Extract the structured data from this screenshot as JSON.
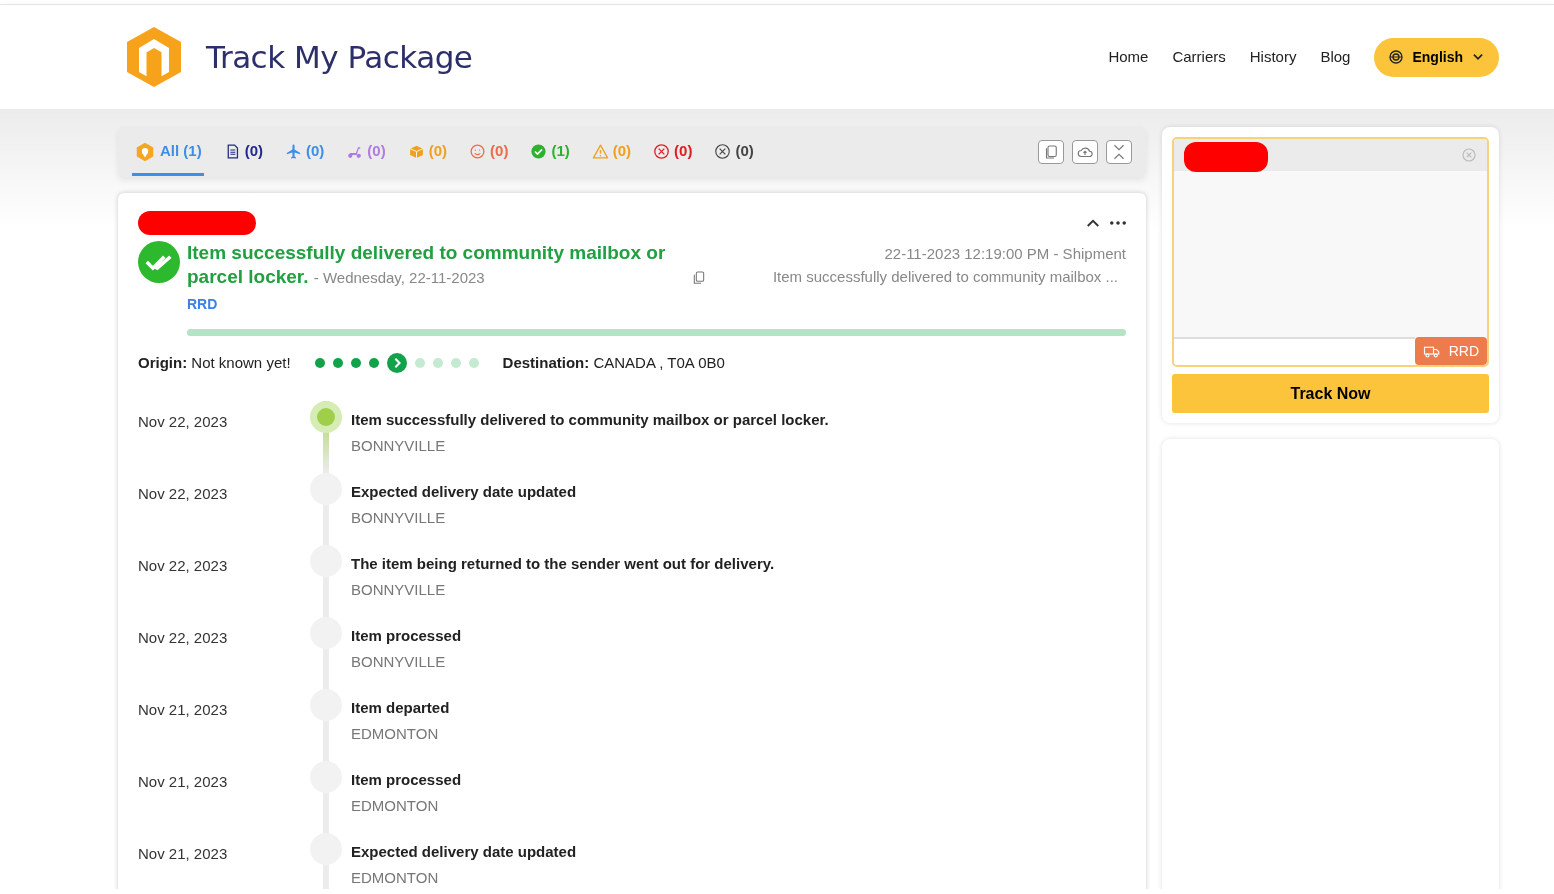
{
  "brand": {
    "name": "Track My Package"
  },
  "nav": {
    "links": [
      "Home",
      "Carriers",
      "History",
      "Blog"
    ],
    "language": "English"
  },
  "tabs": [
    {
      "kind": "all",
      "label": "All",
      "count": "(1)",
      "color": "#3d8ee8",
      "selected": true
    },
    {
      "kind": "document",
      "count": "(0)",
      "color": "#1f2a8a",
      "selected": false
    },
    {
      "kind": "plane",
      "count": "(0)",
      "color": "#3d8ee8",
      "selected": false
    },
    {
      "kind": "scooter",
      "count": "(0)",
      "color": "#b07be0",
      "selected": false
    },
    {
      "kind": "box",
      "count": "(0)",
      "color": "#f0a020",
      "selected": false
    },
    {
      "kind": "face",
      "count": "(0)",
      "color": "#ec6b4a",
      "selected": false
    },
    {
      "kind": "check",
      "count": "(1)",
      "color": "#2db22d",
      "selected": false
    },
    {
      "kind": "warning",
      "count": "(0)",
      "color": "#f0a020",
      "selected": false
    },
    {
      "kind": "error",
      "count": "(0)",
      "color": "#e01b24",
      "selected": false
    },
    {
      "kind": "cancel",
      "count": "(0)",
      "color": "#444444",
      "selected": false
    }
  ],
  "shipment": {
    "status_title": "Item successfully delivered to community mailbox or parcel locker.",
    "status_date": "- Wednesday, 22-11-2023",
    "carrier": "RRD",
    "updated": "22-11-2023 12:19:00 PM - Shipment",
    "summary": "Item successfully delivered to community mailbox ...",
    "progress": {
      "level": 1
    },
    "origin_label": "Origin:",
    "origin": "Not known yet!",
    "destination_label": "Destination:",
    "destination": "CANADA , T0A 0B0",
    "route_dots": [
      {
        "kind": "done"
      },
      {
        "kind": "done"
      },
      {
        "kind": "done"
      },
      {
        "kind": "done"
      },
      {
        "kind": "current"
      },
      {
        "kind": "pending"
      },
      {
        "kind": "pending"
      },
      {
        "kind": "pending"
      },
      {
        "kind": "pending"
      }
    ],
    "events": [
      {
        "date": "Nov 22, 2023",
        "title": "Item successfully delivered to community mailbox or parcel locker.",
        "location": "BONNYVILLE",
        "current": true
      },
      {
        "date": "Nov 22, 2023",
        "title": "Expected delivery date updated",
        "location": "BONNYVILLE",
        "current": false
      },
      {
        "date": "Nov 22, 2023",
        "title": "The item being returned to the sender went out for delivery.",
        "location": "BONNYVILLE",
        "current": false
      },
      {
        "date": "Nov 22, 2023",
        "title": "Item processed",
        "location": "BONNYVILLE",
        "current": false
      },
      {
        "date": "Nov 21, 2023",
        "title": "Item departed",
        "location": "EDMONTON",
        "current": false
      },
      {
        "date": "Nov 21, 2023",
        "title": "Item processed",
        "location": "EDMONTON",
        "current": false
      },
      {
        "date": "Nov 21, 2023",
        "title": "Expected delivery date updated",
        "location": "EDMONTON",
        "current": false
      }
    ]
  },
  "tracker": {
    "carrier": "RRD",
    "button": "Track Now"
  }
}
